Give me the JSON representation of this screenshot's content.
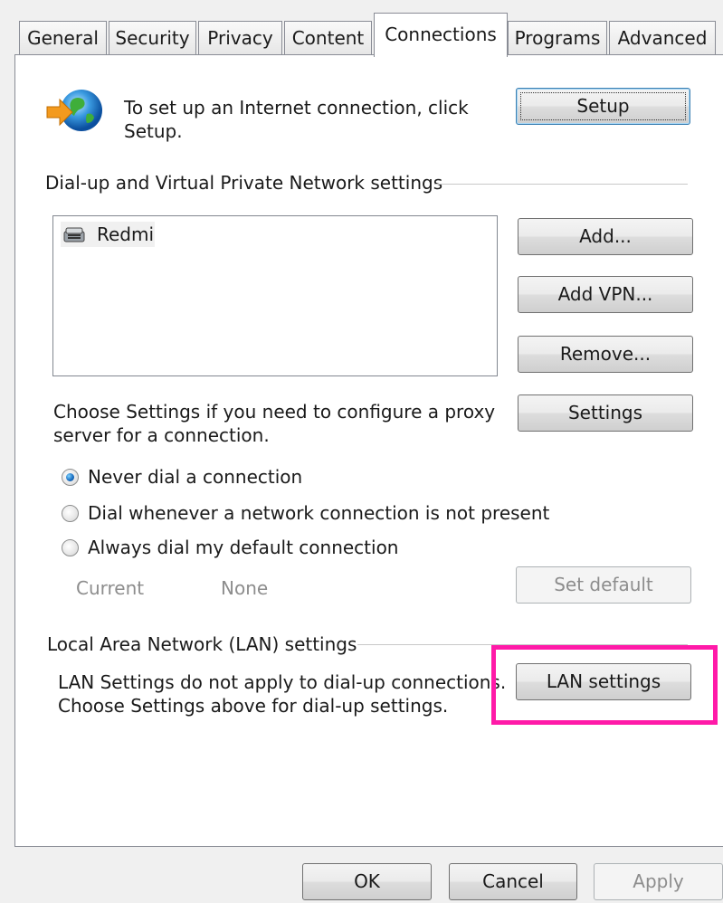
{
  "tabs": [
    "General",
    "Security",
    "Privacy",
    "Content",
    "Connections",
    "Programs",
    "Advanced"
  ],
  "active_tab": "Connections",
  "setup": {
    "text_line1": "To set up an Internet connection, click",
    "text_line2": "Setup.",
    "button": "Setup"
  },
  "dialup": {
    "group_label": "Dial-up and Virtual Private Network settings",
    "connections": [
      "Redmi"
    ],
    "add_button": "Add...",
    "add_vpn_button": "Add VPN...",
    "remove_button": "Remove...",
    "settings_button": "Settings",
    "proxy_text_line1": "Choose Settings if you need to configure a proxy",
    "proxy_text_line2": "server for a connection."
  },
  "dial_options": {
    "never": "Never dial a connection",
    "whenever": "Dial whenever a network connection is not present",
    "always": "Always dial my default connection",
    "selected": "never",
    "current_label": "Current",
    "current_value": "None",
    "set_default_button": "Set default"
  },
  "lan": {
    "group_label": "Local Area Network (LAN) settings",
    "text_line1": "LAN Settings do not apply to dial-up connections.",
    "text_line2": "Choose Settings above for dial-up settings.",
    "button": "LAN settings"
  },
  "footer": {
    "ok": "OK",
    "cancel": "Cancel",
    "apply": "Apply"
  },
  "colors": {
    "highlight": "#ff1aa8"
  }
}
